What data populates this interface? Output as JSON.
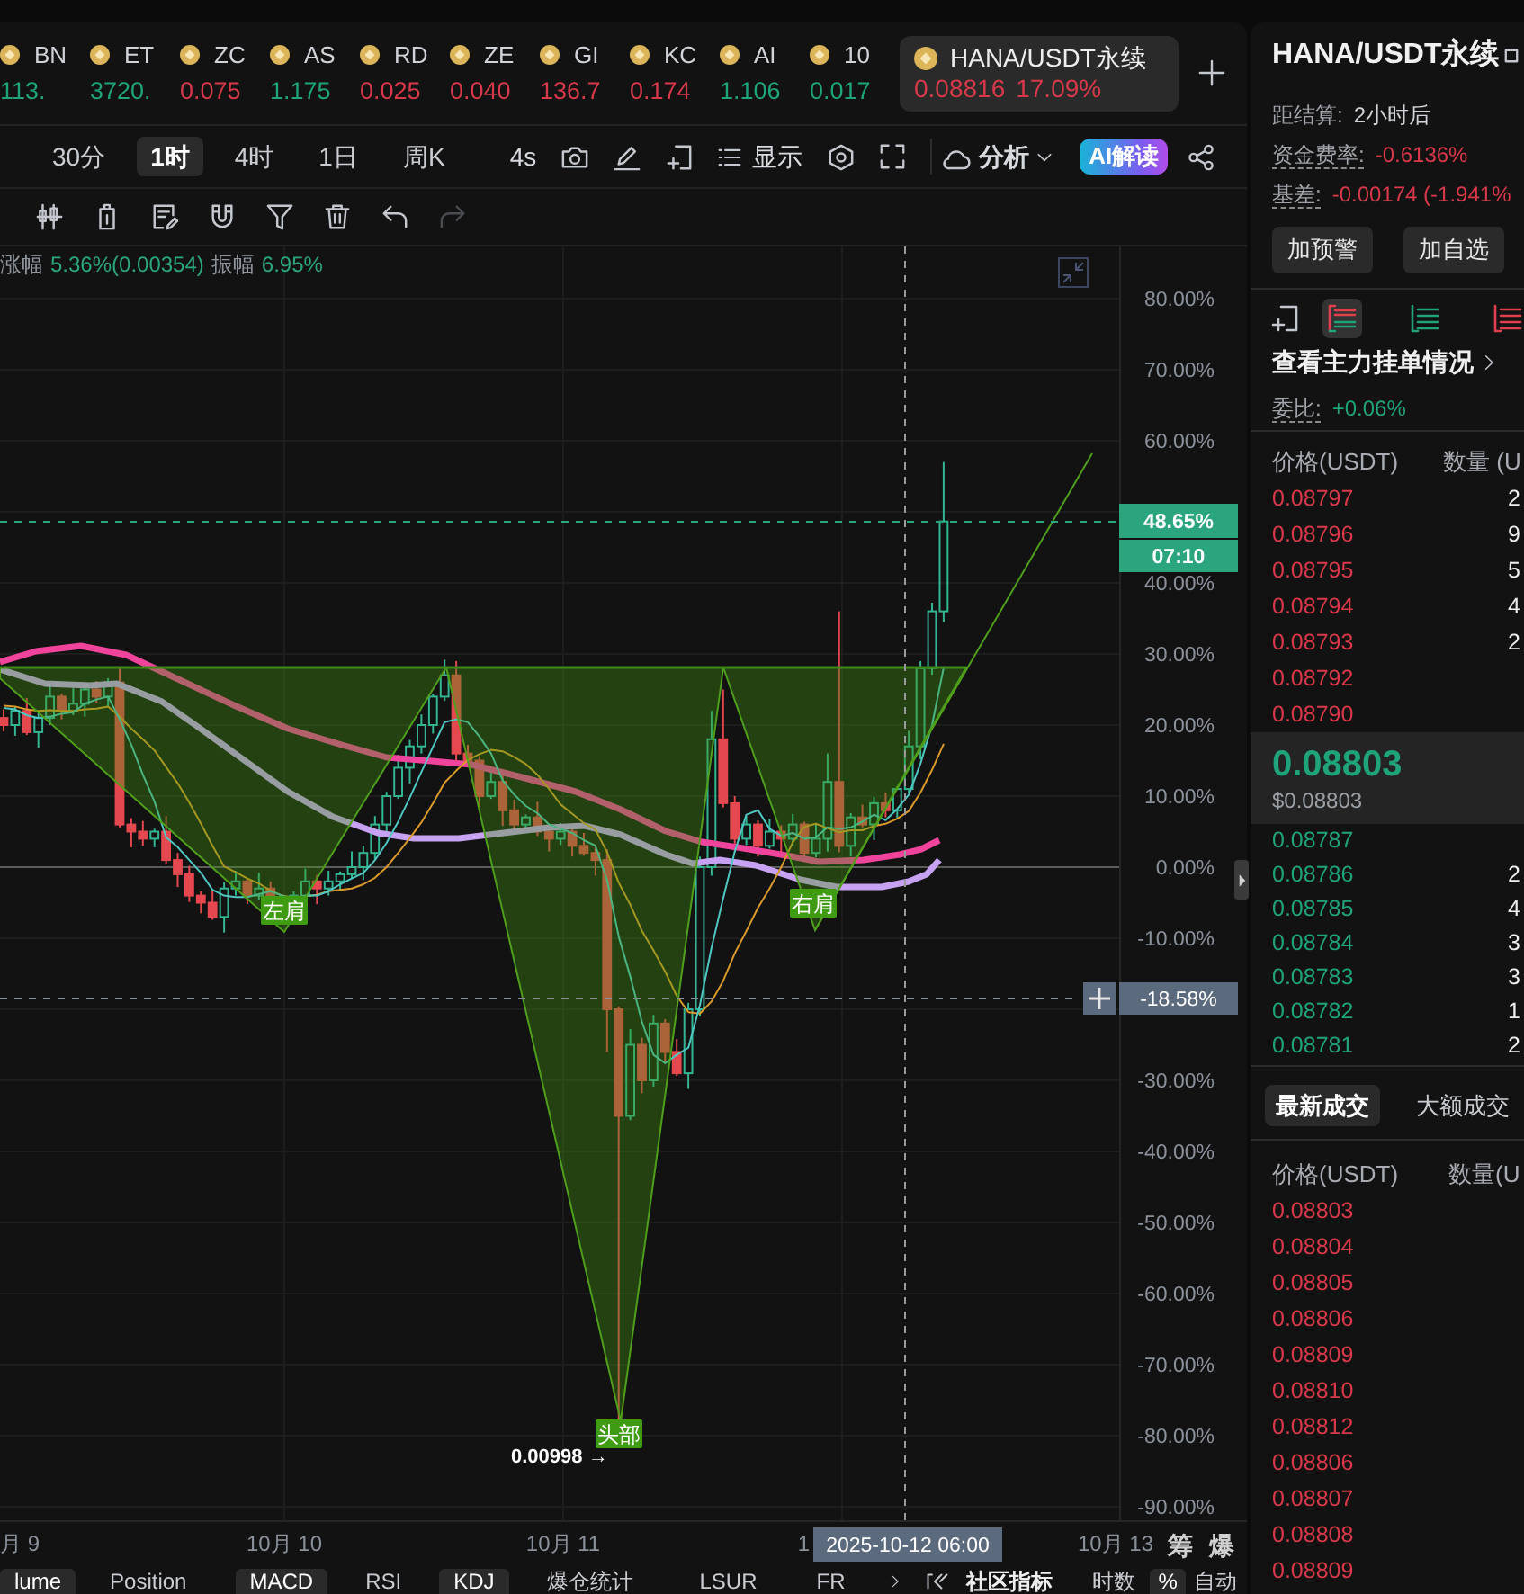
{
  "tickers": [
    {
      "symbol": "BN",
      "price": "113.",
      "color": "#1fa37a"
    },
    {
      "symbol": "ET",
      "price": "3720.",
      "color": "#1fa37a"
    },
    {
      "symbol": "ZC",
      "price": "0.075",
      "color": "#d8394a"
    },
    {
      "symbol": "AS",
      "price": "1.175",
      "color": "#1fa37a"
    },
    {
      "symbol": "RD",
      "price": "0.025",
      "color": "#d8394a"
    },
    {
      "symbol": "ZE",
      "price": "0.040",
      "color": "#d8394a"
    },
    {
      "symbol": "GI",
      "price": "136.7",
      "color": "#d8394a"
    },
    {
      "symbol": "KC",
      "price": "0.174",
      "color": "#d8394a"
    },
    {
      "symbol": "AI",
      "price": "1.106",
      "color": "#1fa37a"
    },
    {
      "symbol": "10",
      "price": "0.017",
      "color": "#1fa37a"
    }
  ],
  "active_ticker": {
    "symbol": "HANA/USDT永续",
    "price": "0.08816",
    "change": "17.09%",
    "color": "#d8394a"
  },
  "intervals": [
    {
      "label": "30分",
      "selected": false
    },
    {
      "label": "1时",
      "selected": true
    },
    {
      "label": "4时",
      "selected": false
    },
    {
      "label": "1日",
      "selected": false
    },
    {
      "label": "周K",
      "selected": false
    }
  ],
  "toolbar": {
    "refresh": "4s",
    "display": "显示",
    "analysis": "分析",
    "ai_button": "AI解读"
  },
  "chart": {
    "legend": [
      {
        "label": "涨幅",
        "value": "5.36%(0.00354)"
      },
      {
        "label": "振幅",
        "value": "6.95%"
      }
    ],
    "y_axis": [
      "80.00%",
      "70.00%",
      "60.00%",
      "40.00%",
      "30.00%",
      "20.00%",
      "10.00%",
      "0.00%",
      "-10.00%",
      "-30.00%",
      "-40.00%",
      "-50.00%",
      "-60.00%",
      "-70.00%",
      "-80.00%",
      "-90.00%"
    ],
    "x_axis": [
      "月 9",
      "10月 10",
      "10月 11",
      "1",
      "10月 13"
    ],
    "price_badge": "48.65%",
    "countdown": "07:10",
    "crosshair_price": "-18.58%",
    "crosshair_time": "2025-10-12 06:00",
    "pattern_labels": [
      "左肩",
      "头部",
      "右肩"
    ],
    "low_label": "0.00998 →",
    "side_buttons": [
      "筹",
      "爆"
    ]
  },
  "indicator_tabs": [
    {
      "label": "lume",
      "selected": true
    },
    {
      "label": "Position",
      "selected": false
    },
    {
      "label": "MACD",
      "selected": true
    },
    {
      "label": "RSI",
      "selected": false
    },
    {
      "label": "KDJ",
      "selected": true
    },
    {
      "label": "爆仓统计",
      "selected": false
    },
    {
      "label": "LSUR",
      "selected": false
    },
    {
      "label": "FR",
      "selected": false
    }
  ],
  "indicator_more": {
    "community": "社区指标",
    "timing": "时数",
    "percent": {
      "label": "%",
      "selected": true
    },
    "auto": "自动"
  },
  "panel": {
    "title": "HANA/USDT永续",
    "settlement": {
      "label": "距结算:",
      "value": "2小时后"
    },
    "funding": {
      "label": "资金费率:",
      "value": "-0.6136%"
    },
    "basis": {
      "label": "基差:",
      "value": "-0.00174 (-1.941%"
    },
    "buttons": [
      "加预警",
      "加自选"
    ],
    "book_views": [
      {
        "kind": "both",
        "selected": true
      },
      {
        "kind": "bids",
        "selected": false
      },
      {
        "kind": "asks",
        "selected": false
      }
    ],
    "big_orders": "查看主力挂单情况",
    "ratio": {
      "label": "委比:",
      "value": "+0.06%"
    },
    "book_header": {
      "price": "价格(USDT)",
      "qty": "数量 (U"
    },
    "asks": [
      {
        "price": "0.08797",
        "qty": "2"
      },
      {
        "price": "0.08796",
        "qty": "9"
      },
      {
        "price": "0.08795",
        "qty": "5"
      },
      {
        "price": "0.08794",
        "qty": "4"
      },
      {
        "price": "0.08793",
        "qty": "2"
      },
      {
        "price": "0.08792"
      },
      {
        "price": "0.08790"
      }
    ],
    "last_price": "0.08803",
    "last_price_usd": "$0.08803",
    "bids": [
      {
        "price": "0.08787"
      },
      {
        "price": "0.08786",
        "qty": "2"
      },
      {
        "price": "0.08785",
        "qty": "4"
      },
      {
        "price": "0.08784",
        "qty": "3"
      },
      {
        "price": "0.08783",
        "qty": "3"
      },
      {
        "price": "0.08782",
        "qty": "1"
      },
      {
        "price": "0.08781",
        "qty": "2"
      }
    ],
    "trade_tabs": [
      {
        "label": "最新成交",
        "selected": true
      },
      {
        "label": "大额成交",
        "selected": false
      }
    ],
    "trades_header": {
      "price": "价格(USDT)",
      "qty": "数量(U"
    },
    "trades": [
      "0.08803",
      "0.08804",
      "0.08805",
      "0.08806",
      "0.08809",
      "0.08810",
      "0.08812",
      "0.08806",
      "0.08807",
      "0.08808",
      "0.08809"
    ]
  }
}
